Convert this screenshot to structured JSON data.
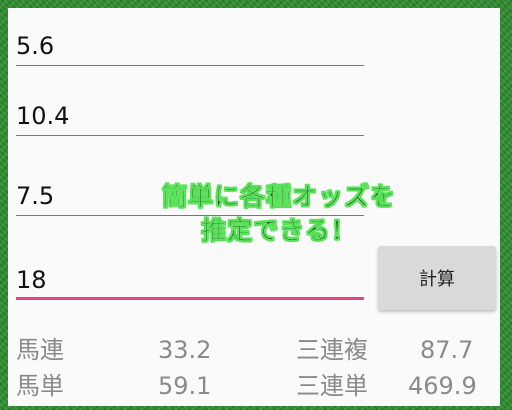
{
  "inputs": [
    {
      "value": "5.6"
    },
    {
      "value": "10.4"
    },
    {
      "value": "7.5"
    },
    {
      "value": "18"
    }
  ],
  "button": {
    "label": "計算"
  },
  "banner": {
    "line1": "簡単に各種オッズを",
    "line2": "推定できる！"
  },
  "results": {
    "umaren": {
      "label": "馬連",
      "value": "33.2"
    },
    "sanrenpuku": {
      "label": "三連複",
      "value": "87.7"
    },
    "umatan": {
      "label": "馬単",
      "value": "59.1"
    },
    "sanrentan": {
      "label": "三連単",
      "value": "469.9"
    }
  },
  "colors": {
    "accent_underline": "#e4457a",
    "banner_glow": "#4fe34f",
    "border_green": "#2f8f2f"
  }
}
